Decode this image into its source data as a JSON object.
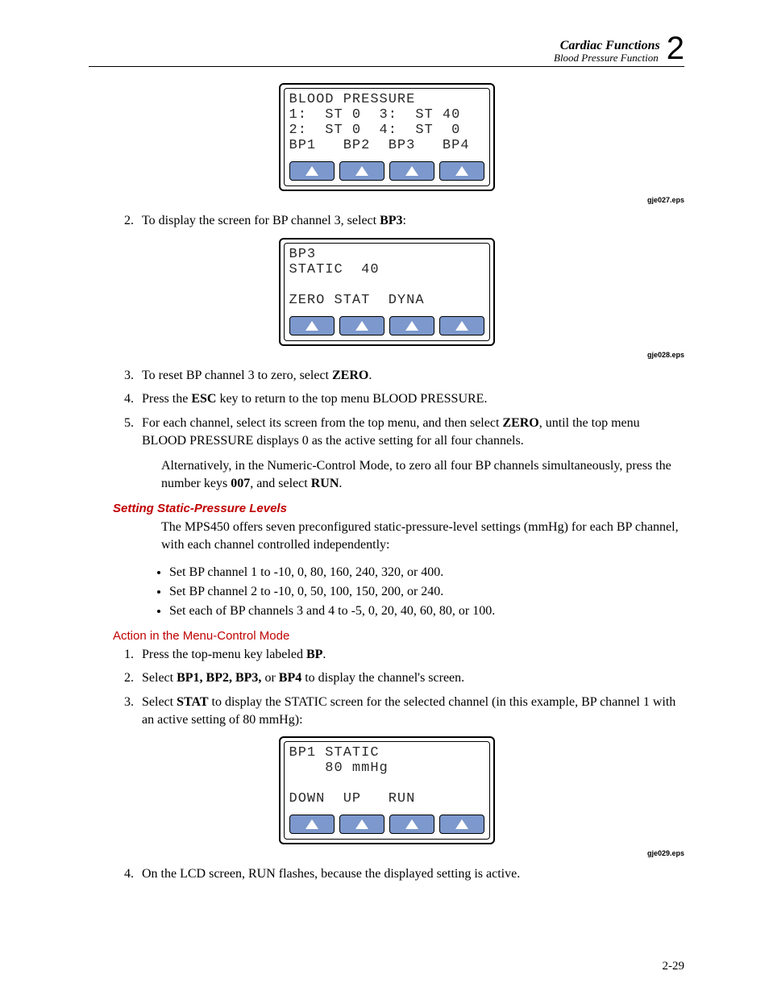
{
  "header": {
    "title": "Cardiac Functions",
    "subtitle": "Blood Pressure Function",
    "chapter": "2"
  },
  "lcd1": {
    "line1": "BLOOD PRESSURE",
    "line2": "1:  ST 0  3:  ST 40",
    "line3": "2:  ST 0  4:  ST  0",
    "line4": "BP1   BP2  BP3   BP4",
    "caption": "gje027.eps"
  },
  "step2": {
    "prefix": "To display the screen for BP channel 3, select ",
    "bold": "BP3",
    "suffix": ":"
  },
  "lcd2": {
    "line1": "BP3",
    "line2": "STATIC  40",
    "line3": "",
    "line4": "ZERO STAT  DYNA",
    "caption": "gje028.eps"
  },
  "step3": {
    "prefix": "To reset BP channel 3 to zero, select ",
    "bold": "ZERO",
    "suffix": "."
  },
  "step4": {
    "prefix": "Press the ",
    "bold": "ESC",
    "suffix": " key to return to the top menu BLOOD PRESSURE."
  },
  "step5": {
    "prefix": "For each channel, select its screen from the top menu, and then select ",
    "bold": "ZERO",
    "suffix": ", until the top menu BLOOD PRESSURE displays 0 as the active setting for all four channels."
  },
  "alt": {
    "p1": "Alternatively, in the Numeric-Control Mode, to zero all four BP channels simultaneously, press the number keys ",
    "b1": "007",
    "p2": ", and select ",
    "b2": "RUN",
    "p3": "."
  },
  "sec1": {
    "heading": "Setting Static-Pressure Levels",
    "intro": "The MPS450 offers seven preconfigured static-pressure-level settings (mmHg) for each BP channel, with each channel controlled independently:",
    "bullets": [
      "Set BP channel 1 to -10, 0, 80, 160, 240, 320, or 400.",
      "Set BP channel 2 to -10, 0, 50, 100, 150, 200, or 240.",
      "Set each of BP channels 3 and 4 to -5, 0, 20, 40, 60, 80, or 100."
    ]
  },
  "sec2": {
    "heading": "Action in the Menu-Control Mode",
    "step1": {
      "prefix": "Press the top-menu key labeled ",
      "bold": "BP",
      "suffix": "."
    },
    "step2": {
      "prefix": "Select ",
      "bold": "BP1, BP2, BP3,",
      "mid": " or ",
      "bold2": "BP4",
      "suffix": " to display the channel's screen."
    },
    "step3": {
      "prefix": "Select ",
      "bold": "STAT",
      "suffix": " to display the STATIC screen for the selected channel (in this example, BP channel 1 with an active setting of 80 mmHg):"
    }
  },
  "lcd3": {
    "line1": "BP1 STATIC",
    "line2": "    80 mmHg",
    "line3": "",
    "line4": "DOWN  UP   RUN",
    "caption": "gje029.eps"
  },
  "step_after3": "On the LCD screen, RUN flashes, because the displayed setting is active.",
  "page_number": "2-29"
}
